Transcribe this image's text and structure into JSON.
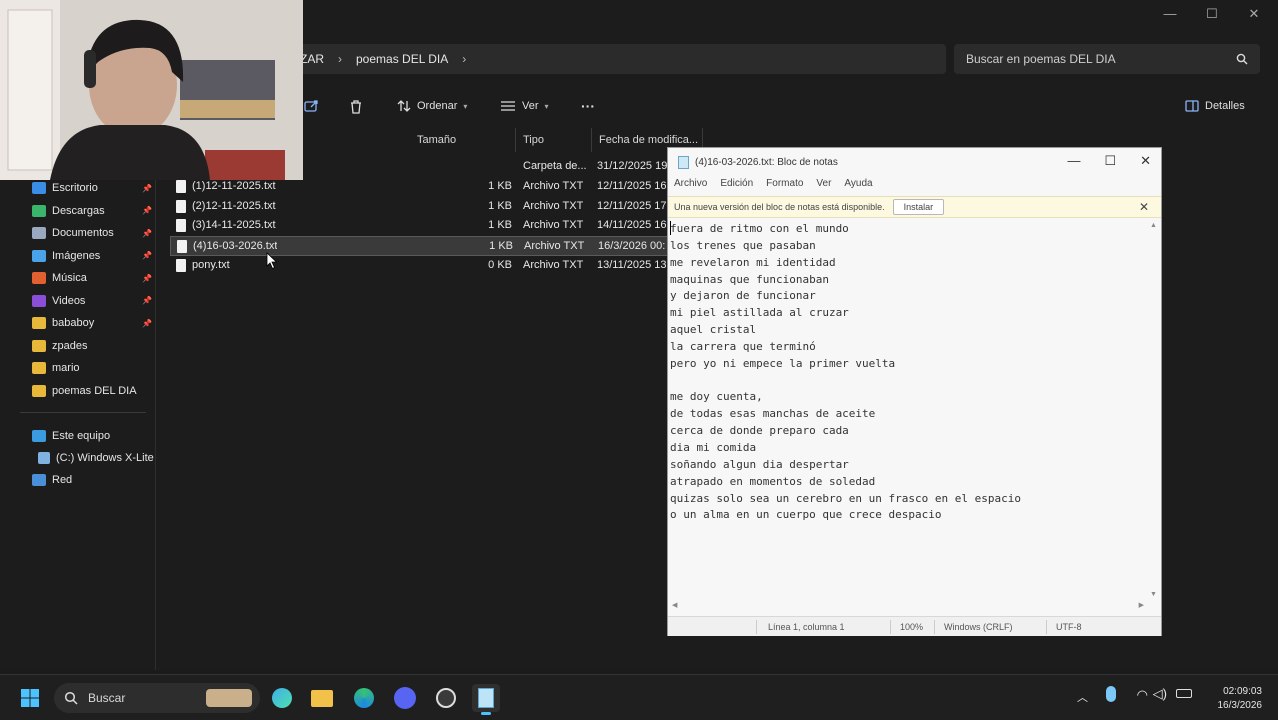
{
  "explorer": {
    "breadcrumb": [
      "ZAR",
      "poemas DEL DIA"
    ],
    "search_placeholder": "Buscar en poemas DEL DIA",
    "commands": {
      "sort": "Ordenar",
      "view": "Ver",
      "more": "···",
      "details": "Detalles"
    },
    "window_controls": {
      "minimize": "—",
      "maximize": "☐",
      "close": "✕"
    },
    "sidebar": {
      "quick": [
        {
          "label": "Escritorio",
          "icon": "desktop-icon",
          "color": "#3a8ee6",
          "pinned": true
        },
        {
          "label": "Descargas",
          "icon": "download-icon",
          "color": "#3bb56b",
          "pinned": true
        },
        {
          "label": "Documentos",
          "icon": "document-icon",
          "color": "#9aa8c0",
          "pinned": true
        },
        {
          "label": "Imágenes",
          "icon": "image-icon",
          "color": "#4aa3e8",
          "pinned": true
        },
        {
          "label": "Música",
          "icon": "music-icon",
          "color": "#e0602f",
          "pinned": true
        },
        {
          "label": "Videos",
          "icon": "video-icon",
          "color": "#8a4fd6",
          "pinned": true
        },
        {
          "label": "bababoy",
          "icon": "folder-icon",
          "color": "#e8b83a",
          "pinned": true
        },
        {
          "label": "zpades",
          "icon": "folder-icon",
          "color": "#e8b83a",
          "pinned": false
        },
        {
          "label": "mario",
          "icon": "folder-icon",
          "color": "#e8b83a",
          "pinned": false
        },
        {
          "label": "poemas DEL DIA",
          "icon": "folder-icon",
          "color": "#e8b83a",
          "pinned": false
        }
      ],
      "pin_glyph": "📌",
      "this_pc": "Este equipo",
      "drive": "(C:) Windows X-Lite",
      "network": "Red"
    },
    "columns": {
      "size": "Tamaño",
      "type": "Tipo",
      "date": "Fecha de modifica..."
    },
    "files": [
      {
        "name": "",
        "size": "",
        "type": "Carpeta de...",
        "date": "31/12/2025 19",
        "selected": false,
        "is_folder": true
      },
      {
        "name": "(1)12-11-2025.txt",
        "size": "1 KB",
        "type": "Archivo TXT",
        "date": "12/11/2025 16",
        "selected": false
      },
      {
        "name": "(2)12-11-2025.txt",
        "size": "1 KB",
        "type": "Archivo TXT",
        "date": "12/11/2025 17",
        "selected": false
      },
      {
        "name": "(3)14-11-2025.txt",
        "size": "1 KB",
        "type": "Archivo TXT",
        "date": "14/11/2025 16",
        "selected": false
      },
      {
        "name": "(4)16-03-2026.txt",
        "size": "1 KB",
        "type": "Archivo TXT",
        "date": "16/3/2026 00:",
        "selected": true
      },
      {
        "name": "pony.txt",
        "size": "0 KB",
        "type": "Archivo TXT",
        "date": "13/11/2025 13",
        "selected": false
      }
    ]
  },
  "notepad": {
    "title": "(4)16-03-2026.txt: Bloc de notas",
    "menu": [
      "Archivo",
      "Edición",
      "Formato",
      "Ver",
      "Ayuda"
    ],
    "info_text": "Una nueva versión del bloc de notas está disponible.",
    "install_label": "Instalar",
    "info_close": "✕",
    "lines": [
      "fuera de ritmo con el mundo",
      "los trenes que pasaban",
      "me revelaron mi identidad",
      "maquinas que funcionaban",
      "y dejaron de funcionar",
      "mi piel astillada al cruzar",
      "aquel cristal",
      "la carrera que terminó",
      "pero yo ni empece la primer vuelta",
      "",
      "me doy cuenta,",
      "de todas esas manchas de aceite",
      "cerca de donde preparo cada",
      "dia mi comida",
      "soñando algun dia despertar",
      "atrapado en momentos de soledad",
      "quizas solo sea un cerebro en un frasco en el espacio",
      "o un alma en un cuerpo que crece despacio"
    ],
    "status": {
      "position": "Línea 1, columna 1",
      "zoom": "100%",
      "eol": "Windows (CRLF)",
      "encoding": "UTF-8"
    }
  },
  "taskbar": {
    "search_label": "Buscar",
    "time": "02:09:03",
    "date": "16/3/2026",
    "apps": [
      "start-icon",
      "copilot-icon",
      "file-explorer-icon",
      "edge-icon",
      "discord-icon",
      "obs-icon",
      "notepad-icon"
    ]
  }
}
